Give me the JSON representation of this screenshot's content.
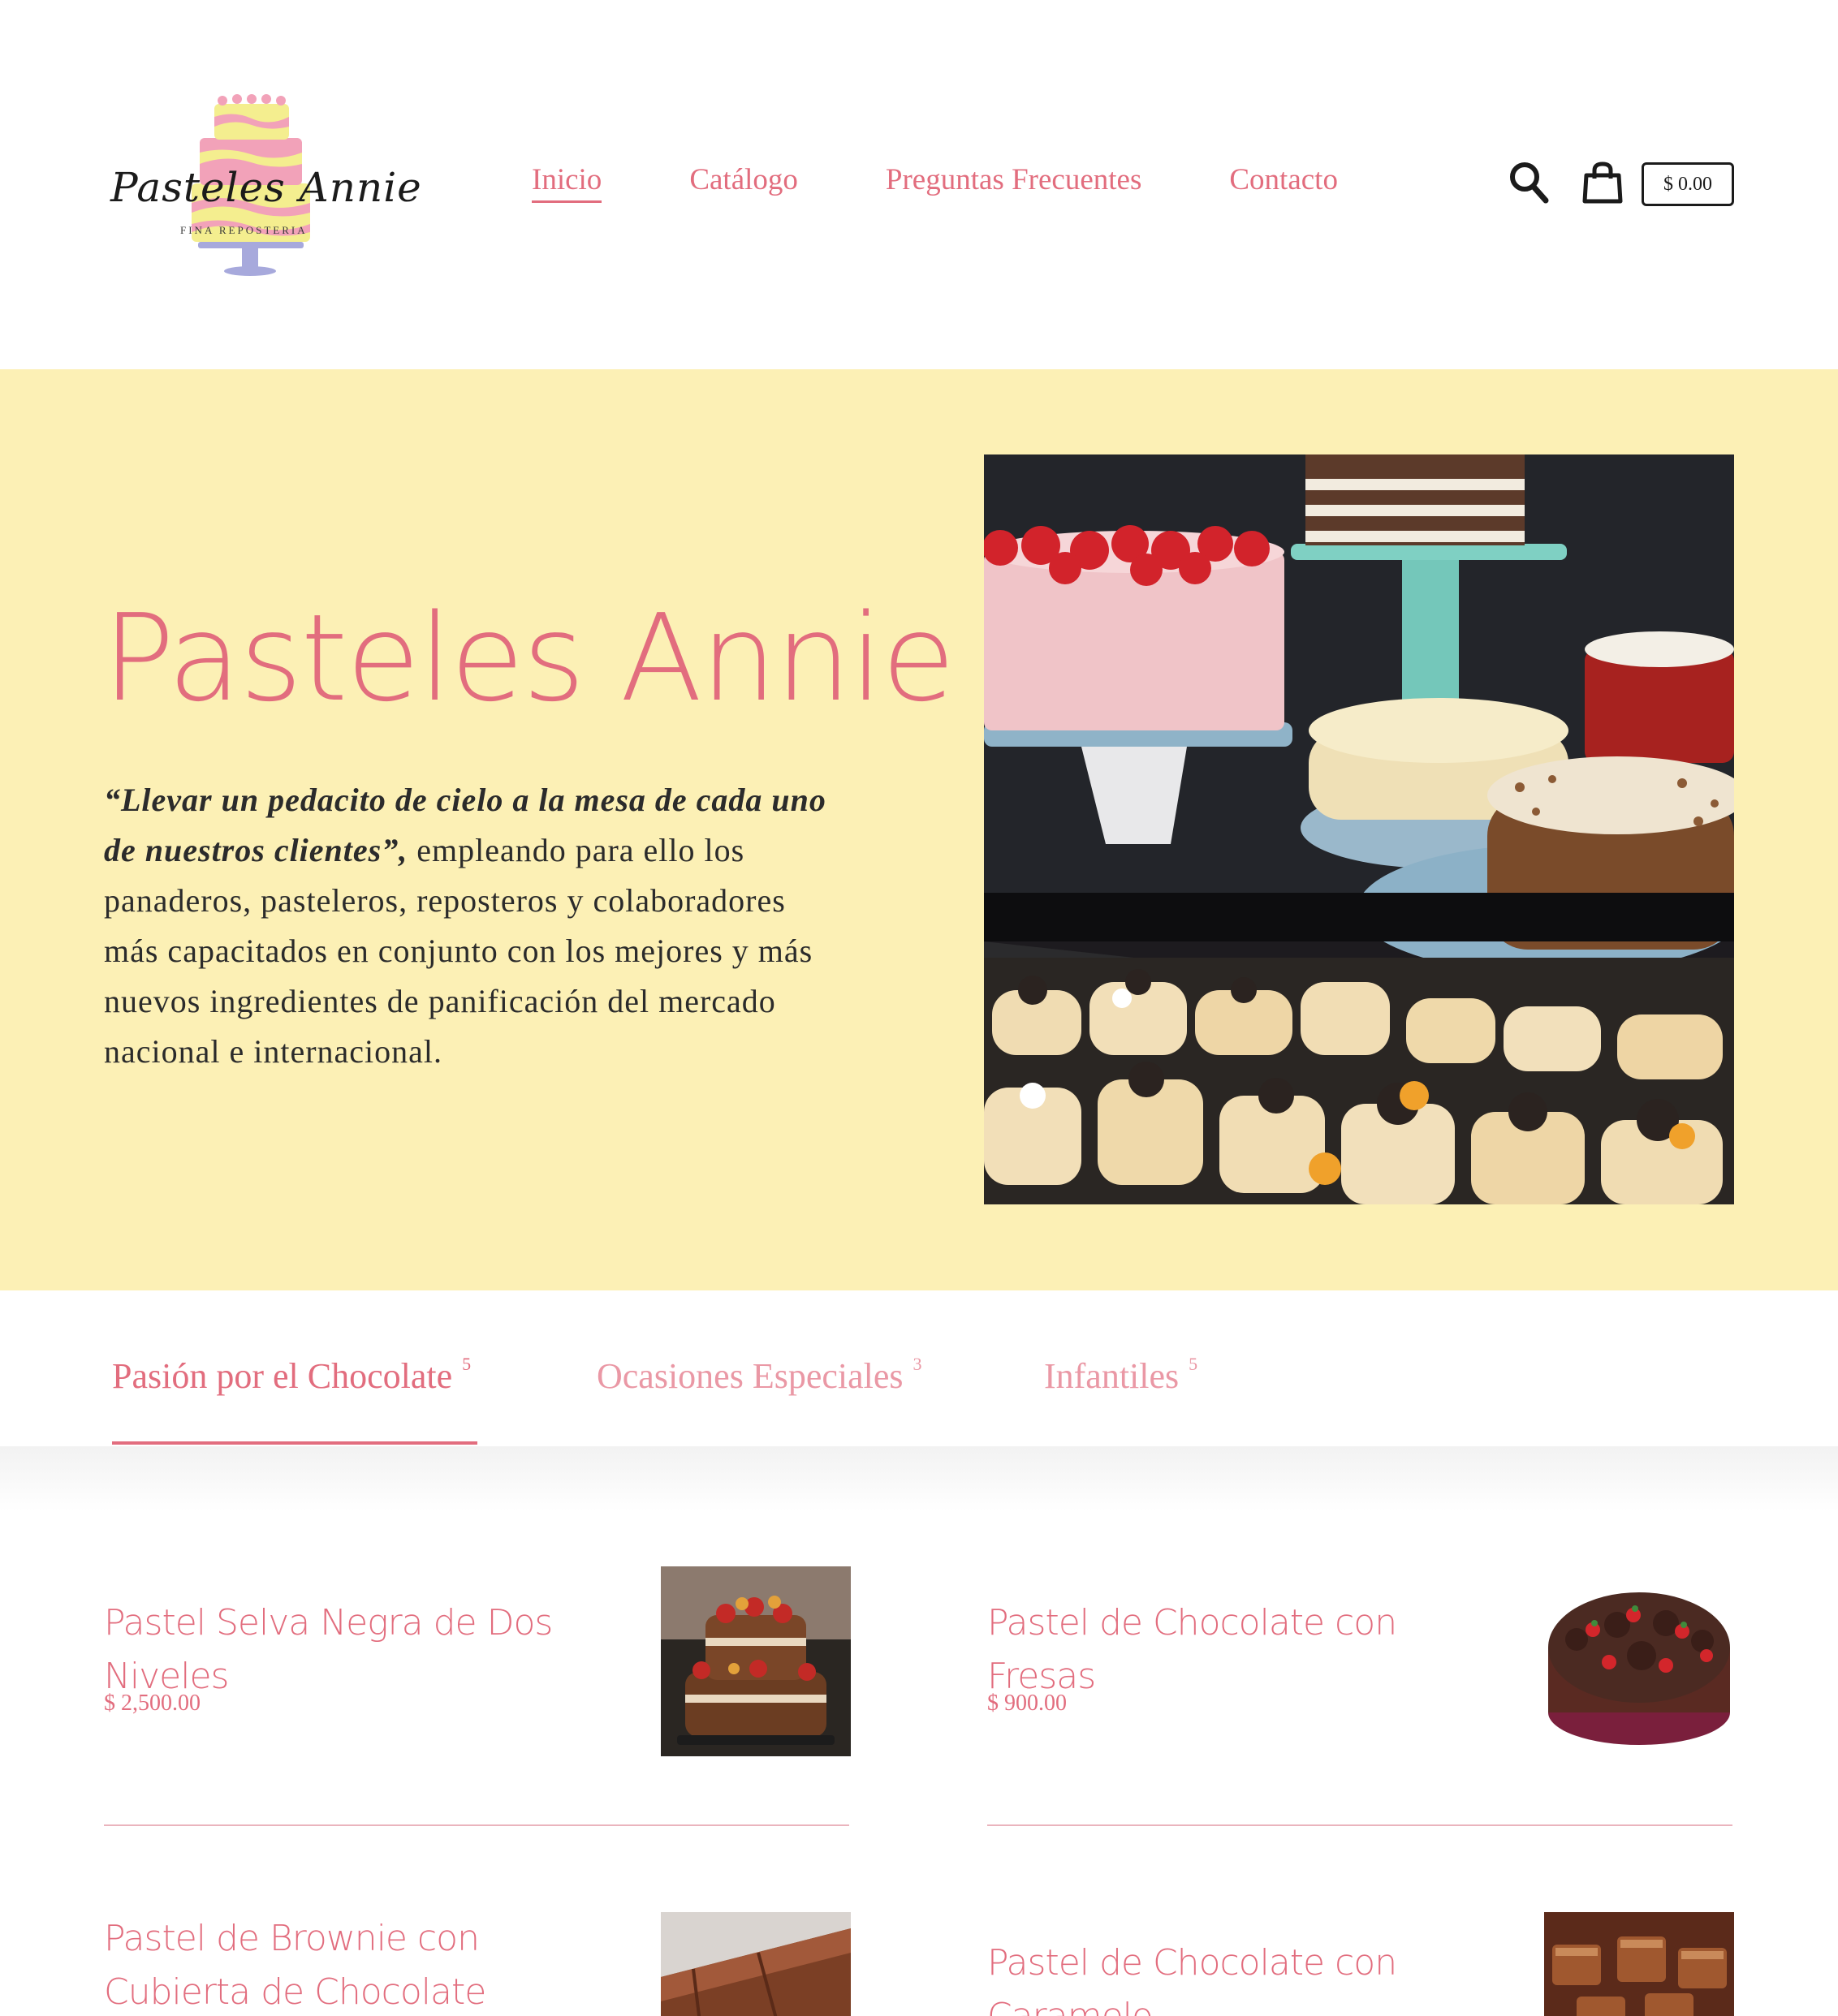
{
  "brand": {
    "name": "Pasteles Annie",
    "tagline": "FINA REPOSTERIA"
  },
  "nav": {
    "items": [
      {
        "label": "Inicio",
        "active": true
      },
      {
        "label": "Catálogo"
      },
      {
        "label": "Preguntas Frecuentes"
      },
      {
        "label": "Contacto"
      }
    ],
    "cart_total": "$ 0.00",
    "icons": [
      "search-icon",
      "shopping-bag-icon"
    ]
  },
  "hero": {
    "title": "Pasteles Annie",
    "quote": "“Llevar un pedacito de cielo a la mesa de cada uno de nuestros clientes”,",
    "body": " empleando para ello los panaderos, pasteleros, reposteros y colaboradores más capacitados en conjunto con los mejores y más nuevos ingredientes de panificación del mercado nacional e internacional."
  },
  "tabs": [
    {
      "label": "Pasión por el Chocolate",
      "count": "5",
      "active": true
    },
    {
      "label": "Ocasiones Especiales",
      "count": "3"
    },
    {
      "label": "Infantiles",
      "count": "5"
    }
  ],
  "products": [
    {
      "title": "Pastel Selva Negra de Dos Niveles",
      "price": "$ 2,500.00"
    },
    {
      "title": "Pastel de Chocolate con Fresas",
      "price": "$ 900.00"
    },
    {
      "title": "Pastel de Brownie con Cubierta de Chocolate",
      "price": ""
    },
    {
      "title": "Pastel de Chocolate con Caramelo",
      "price": ""
    }
  ],
  "colors": {
    "accent": "#e26d7e",
    "hero_bg": "#fcf0b5",
    "text": "#2b2b2b"
  }
}
